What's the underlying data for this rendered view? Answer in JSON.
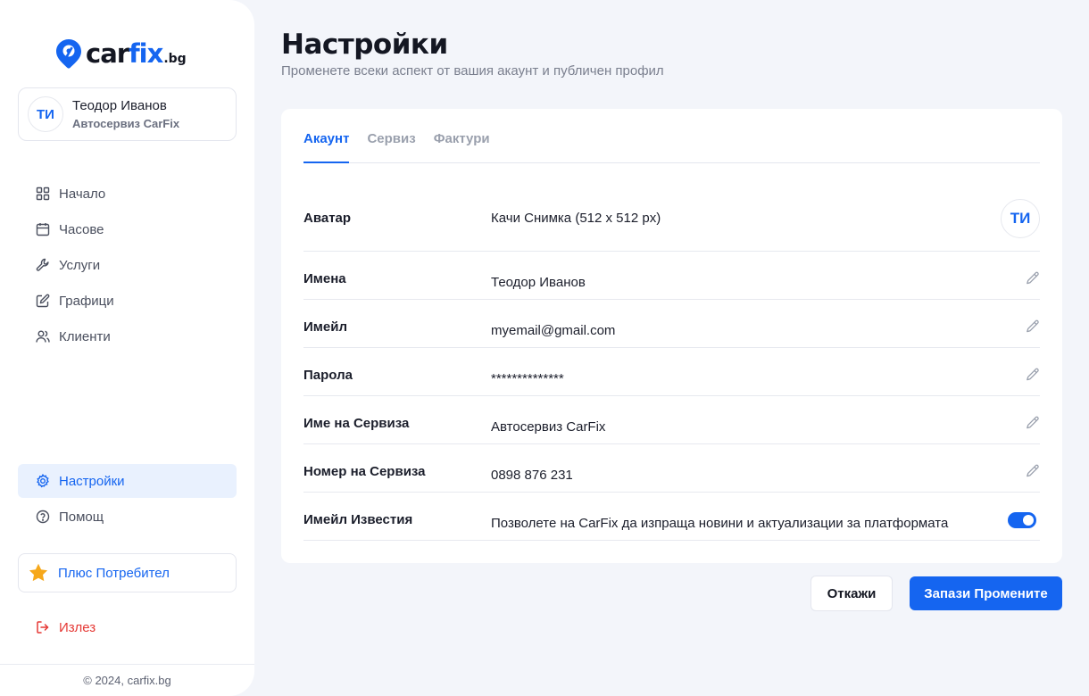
{
  "brand": {
    "name_part1": "car",
    "name_part2": "fix",
    "tld": ".bg",
    "accent_color": "#1565f0"
  },
  "profile": {
    "initials": "ТИ",
    "name": "Теодор Иванов",
    "company": "Автосервиз CarFix"
  },
  "nav": {
    "top": [
      {
        "label": "Начало",
        "icon": "grid-icon"
      },
      {
        "label": "Часове",
        "icon": "calendar-icon"
      },
      {
        "label": "Услуги",
        "icon": "wrench-icon"
      },
      {
        "label": "Графици",
        "icon": "edit-square-icon"
      },
      {
        "label": "Клиенти",
        "icon": "users-icon"
      }
    ],
    "bottom": [
      {
        "label": "Настройки",
        "icon": "gear-icon",
        "active": true
      },
      {
        "label": "Помощ",
        "icon": "help-circle-icon"
      }
    ]
  },
  "plus": {
    "label": "Плюс Потребител",
    "icon": "star-icon"
  },
  "logout": {
    "label": "Излез",
    "icon": "logout-icon",
    "color": "#e53935"
  },
  "footer": {
    "text": "© 2024, carfix.bg"
  },
  "page": {
    "title": "Настройки",
    "subtitle": "Променете всеки аспект от вашия акаунт и публичен профил"
  },
  "tabs": [
    {
      "label": "Акаунт",
      "active": true
    },
    {
      "label": "Сервиз",
      "active": false
    },
    {
      "label": "Фактури",
      "active": false
    }
  ],
  "settings": {
    "avatar": {
      "label": "Аватар",
      "value": "Качи Снимка (512 x 512 px)",
      "initials": "ТИ"
    },
    "name": {
      "label": "Имена",
      "value": "Теодор Иванов"
    },
    "email": {
      "label": "Имейл",
      "value": "myemail@gmail.com"
    },
    "password": {
      "label": "Парола",
      "value": "**************"
    },
    "service_name": {
      "label": "Име на Сервиза",
      "value": "Автосервиз CarFix"
    },
    "service_phone": {
      "label": "Номер на Сервиза",
      "value": "0898 876 231"
    },
    "email_notifications": {
      "label": "Имейл Известия",
      "value": "Позволете на CarFix да изпраща новини и актуализации за платформата",
      "enabled": true
    }
  },
  "actions": {
    "cancel_label": "Откажи",
    "save_label": "Запази Промените"
  }
}
